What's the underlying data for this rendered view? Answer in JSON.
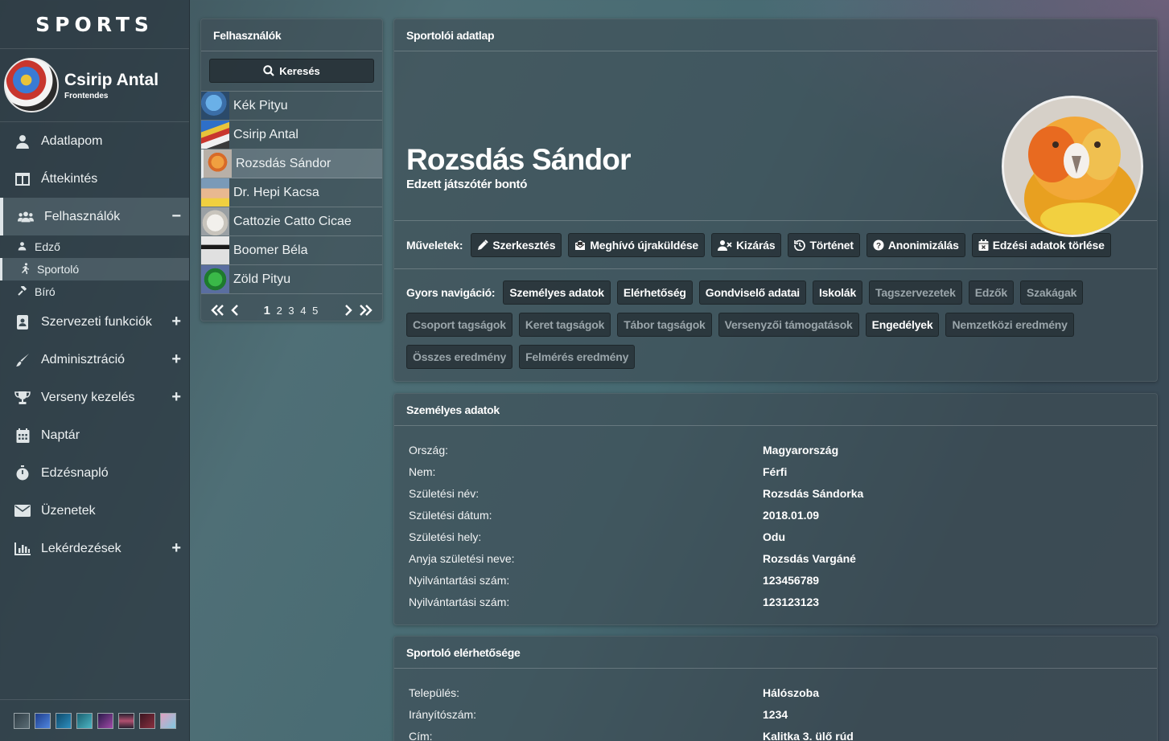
{
  "brand": "SPORTS",
  "user": {
    "name": "Csirip Antal",
    "role": "Frontendes"
  },
  "nav": [
    {
      "label": "Adatlapom",
      "icon": "user-icon",
      "expandable": false
    },
    {
      "label": "Áttekintés",
      "icon": "columns-icon",
      "expandable": false
    },
    {
      "label": "Felhasználók",
      "icon": "users-icon",
      "expandable": true,
      "expanded": true,
      "toggle": "−"
    },
    {
      "label": "Szervezeti funkciók",
      "icon": "address-book-icon",
      "expandable": true,
      "toggle": "+"
    },
    {
      "label": "Adminisztráció",
      "icon": "brush-icon",
      "expandable": true,
      "toggle": "+"
    },
    {
      "label": "Verseny kezelés",
      "icon": "trophy-icon",
      "expandable": true,
      "toggle": "+"
    },
    {
      "label": "Naptár",
      "icon": "calendar-icon",
      "expandable": false
    },
    {
      "label": "Edzésnapló",
      "icon": "stopwatch-icon",
      "expandable": false
    },
    {
      "label": "Üzenetek",
      "icon": "envelope-icon",
      "expandable": false
    },
    {
      "label": "Lekérdezések",
      "icon": "chart-icon",
      "expandable": true,
      "toggle": "+"
    }
  ],
  "subnav": [
    {
      "label": "Edző",
      "icon": "user-small-icon"
    },
    {
      "label": "Sportoló",
      "icon": "running-icon"
    },
    {
      "label": "Bíró",
      "icon": "gavel-icon"
    }
  ],
  "theme_swatches": [
    "#3b4a52",
    "#2e5aa8",
    "#1b6a8a",
    "#2a8c9a",
    "#5a2a6a",
    "#6a2a48",
    "#5a2030",
    "#d88aa0"
  ],
  "userlist": {
    "title": "Felhasználók",
    "search_label": "Keresés",
    "items": [
      "Kék Pityu",
      "Csirip Antal",
      "Rozsdás Sándor",
      "Dr. Hepi Kacsa",
      "Cattozie Catto Cicae",
      "Boomer Béla",
      "Zöld Pityu"
    ],
    "selected_index": 2,
    "pager": {
      "current": "1",
      "pages": "2 3 4 5"
    }
  },
  "profile": {
    "panel_title": "Sportolói adatlap",
    "name": "Rozsdás Sándor",
    "subtitle": "Edzett játszótér bontó",
    "actions_label": "Műveletek:",
    "actions": [
      {
        "label": "Szerkesztés",
        "icon": "pencil-icon"
      },
      {
        "label": "Meghívó újraküldése",
        "icon": "envelope-open-icon"
      },
      {
        "label": "Kizárás",
        "icon": "user-times-icon"
      },
      {
        "label": "Történet",
        "icon": "history-icon"
      },
      {
        "label": "Anonimizálás",
        "icon": "question-circle-icon"
      },
      {
        "label": "Edzési adatok törlése",
        "icon": "calendar-times-icon"
      }
    ],
    "quicknav_label": "Gyors navigáció:",
    "quicknav": [
      {
        "label": "Személyes adatok",
        "enabled": true
      },
      {
        "label": "Elérhetőség",
        "enabled": true
      },
      {
        "label": "Gondviselő adatai",
        "enabled": true
      },
      {
        "label": "Iskolák",
        "enabled": true
      },
      {
        "label": "Tagszervezetek",
        "enabled": false
      },
      {
        "label": "Edzők",
        "enabled": false
      },
      {
        "label": "Szakágak",
        "enabled": false
      },
      {
        "label": "Csoport tagságok",
        "enabled": false
      },
      {
        "label": "Keret tagságok",
        "enabled": false
      },
      {
        "label": "Tábor tagságok",
        "enabled": false
      },
      {
        "label": "Versenyzői támogatások",
        "enabled": false
      },
      {
        "label": "Engedélyek",
        "enabled": true
      },
      {
        "label": "Nemzetközi eredmény",
        "enabled": false
      },
      {
        "label": "Összes eredmény",
        "enabled": false
      },
      {
        "label": "Felmérés eredmény",
        "enabled": false
      }
    ]
  },
  "personal": {
    "title": "Személyes adatok",
    "rows": [
      {
        "k": "Ország:",
        "v": "Magyarország"
      },
      {
        "k": "Nem:",
        "v": "Férfi"
      },
      {
        "k": "Születési név:",
        "v": "Rozsdás Sándorka"
      },
      {
        "k": "Születési dátum:",
        "v": "2018.01.09"
      },
      {
        "k": "Születési hely:",
        "v": "Odu"
      },
      {
        "k": "Anyja születési neve:",
        "v": "Rozsdás Vargáné"
      },
      {
        "k": "Nyilvántartási szám:",
        "v": "123456789"
      },
      {
        "k": "Nyilvántartási szám:",
        "v": "123123123"
      }
    ]
  },
  "contact": {
    "title": "Sportoló elérhetősége",
    "rows": [
      {
        "k": "Település:",
        "v": "Hálószoba"
      },
      {
        "k": "Irányítószám:",
        "v": "1234"
      },
      {
        "k": "Cím:",
        "v": "Kalitka 3. ülő rúd"
      }
    ]
  }
}
